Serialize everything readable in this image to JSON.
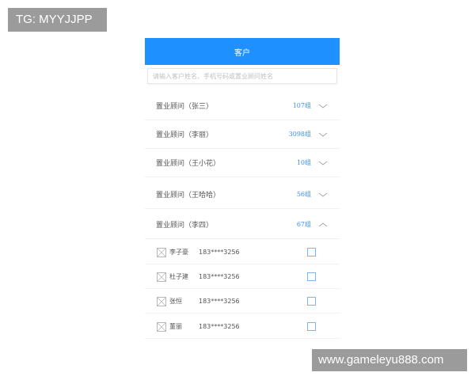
{
  "watermarks": {
    "top_left": "TG: MYYJJPP",
    "bottom_right": "www.gameleyu888.com"
  },
  "header": {
    "title": "客户"
  },
  "search": {
    "placeholder": "请输入客户姓名、手机号码或置业顾问姓名"
  },
  "groups": [
    {
      "label": "置业顾问（张三）",
      "count": "107组",
      "expanded": false
    },
    {
      "label": "置业顾问（李丽）",
      "count": "3098组",
      "expanded": false
    },
    {
      "label": "置业顾问（王小花）",
      "count": "10组",
      "expanded": false
    },
    {
      "label": "置业顾问（王哈哈）",
      "count": "56组",
      "expanded": false
    },
    {
      "label": "置业顾问（李四）",
      "count": "67组",
      "expanded": true
    }
  ],
  "members": [
    {
      "name": "李子豪",
      "phone": "183****3256",
      "checked": false
    },
    {
      "name": "杜子建",
      "phone": "183****3256",
      "checked": false
    },
    {
      "name": "张恒",
      "phone": "183****3256",
      "checked": false
    },
    {
      "name": "董丽",
      "phone": "183****3256",
      "checked": false
    }
  ],
  "colors": {
    "accent": "#1e90ff",
    "count_text": "#3a8fe6",
    "checkbox_border": "#7fb5ee"
  },
  "icons": {
    "collapsed": "chevron-down-icon",
    "expanded": "chevron-up-icon",
    "avatar_placeholder": "image-placeholder-icon"
  }
}
